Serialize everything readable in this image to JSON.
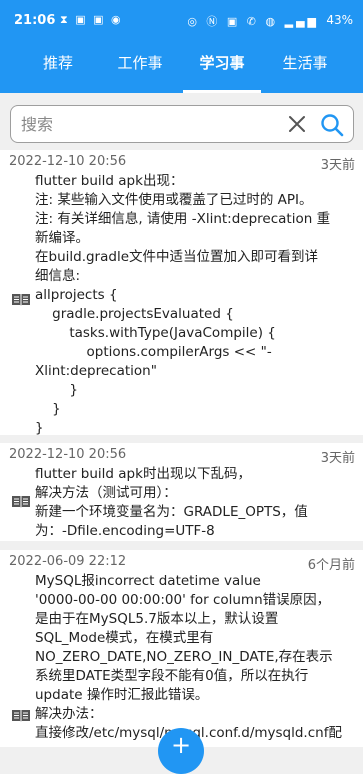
{
  "status_bar": {
    "time": "21:06",
    "left_icons": "⧗ ▣ ▣ ◉",
    "right_icons": "◎ Ⓝ ▣ ✆ ◍ ▂▄▆",
    "battery": "43%"
  },
  "tabs": [
    {
      "label": "推荐",
      "active": false
    },
    {
      "label": "工作事",
      "active": false
    },
    {
      "label": "学习事",
      "active": true
    },
    {
      "label": "生活事",
      "active": false
    }
  ],
  "search": {
    "placeholder": "搜索",
    "value": ""
  },
  "posts": [
    {
      "date": "2022-12-10 20:56",
      "ago": "3天前",
      "lines": [
        "flutter build apk出现：",
        "注: 某些输入文件使用或覆盖了已过时的 API。",
        "注: 有关详细信息, 请使用 -Xlint:deprecation 重",
        "新编译。",
        "在build.gradle文件中适当位置加入即可看到详",
        "细信息:",
        "allprojects {",
        "    gradle.projectsEvaluated {",
        "        tasks.withType(JavaCompile) {",
        "            options.compilerArgs << \"-",
        "Xlint:deprecation\"",
        "        }",
        "    }",
        "}"
      ]
    },
    {
      "date": "2022-12-10 20:56",
      "ago": "3天前",
      "lines": [
        "flutter build apk时出现以下乱码，",
        "解决方法（测试可用）：",
        "新建一个环境变量名为：GRADLE_OPTS，值",
        "为：-Dfile.encoding=UTF-8"
      ]
    },
    {
      "date": "2022-06-09 22:12",
      "ago": "6个月前",
      "lines": [
        "MySQL报incorrect datetime value",
        "'0000-00-00 00:00:00' for column错误原因，",
        "是由于在MySQL5.7版本以上，默认设置",
        "SQL_Mode模式，在模式里有",
        "NO_ZERO_DATE,NO_ZERO_IN_DATE,存在表示",
        "系统里DATE类型字段不能有0值，所以在执行",
        "update 操作时汇报此错误。",
        "解决办法：",
        "直接修改/etc/mysql/mysql.conf.d/mysqld.cnf配"
      ]
    }
  ],
  "fab_label": "+",
  "colors": {
    "primary": "#2196f3",
    "card": "#ffffff",
    "background": "#f0f0f0"
  }
}
